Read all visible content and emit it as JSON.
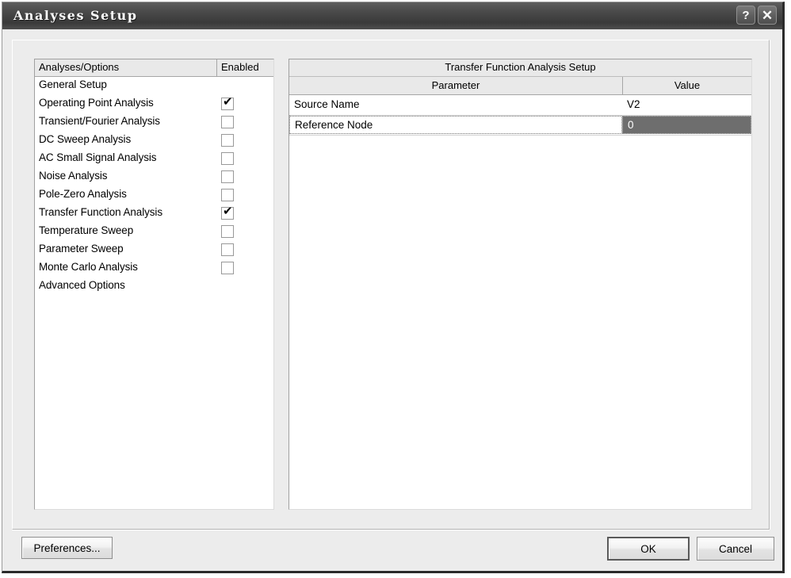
{
  "window": {
    "title": "Analyses Setup",
    "help_button": "?",
    "close_button": "✕"
  },
  "left_list": {
    "headers": {
      "options": "Analyses/Options",
      "enabled": "Enabled"
    },
    "items": [
      {
        "label": "General Setup",
        "has_checkbox": false,
        "checked": false
      },
      {
        "label": "Operating Point Analysis",
        "has_checkbox": true,
        "checked": true
      },
      {
        "label": "Transient/Fourier Analysis",
        "has_checkbox": true,
        "checked": false
      },
      {
        "label": "DC Sweep Analysis",
        "has_checkbox": true,
        "checked": false
      },
      {
        "label": "AC Small Signal Analysis",
        "has_checkbox": true,
        "checked": false
      },
      {
        "label": "Noise Analysis",
        "has_checkbox": true,
        "checked": false
      },
      {
        "label": "Pole-Zero Analysis",
        "has_checkbox": true,
        "checked": false
      },
      {
        "label": "Transfer Function Analysis",
        "has_checkbox": true,
        "checked": true
      },
      {
        "label": "Temperature Sweep",
        "has_checkbox": true,
        "checked": false
      },
      {
        "label": "Parameter Sweep",
        "has_checkbox": true,
        "checked": false
      },
      {
        "label": "Monte Carlo Analysis",
        "has_checkbox": true,
        "checked": false
      },
      {
        "label": "Advanced Options",
        "has_checkbox": false,
        "checked": false
      }
    ],
    "check_glyph": "✔"
  },
  "right_table": {
    "title": "Transfer Function Analysis Setup",
    "headers": {
      "parameter": "Parameter",
      "value": "Value"
    },
    "rows": [
      {
        "parameter": "Source Name",
        "value": "V2",
        "selected": false
      },
      {
        "parameter": "Reference Node",
        "value": "0",
        "selected": true
      }
    ]
  },
  "buttons": {
    "preferences": "Preferences...",
    "ok": "OK",
    "cancel": "Cancel"
  },
  "colors": {
    "selection": "#6e6e6e",
    "dialog_face": "#ececec",
    "header_face": "#e9e9e9",
    "titlebar_dark": "#3a3a3a"
  }
}
